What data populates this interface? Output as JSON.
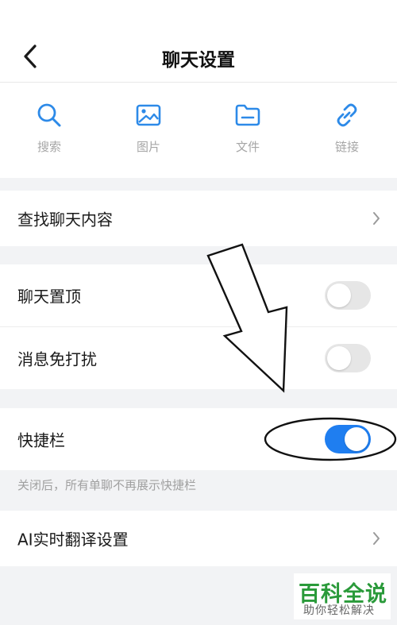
{
  "header": {
    "title": "聊天设置",
    "back_icon": "chevron-left-icon"
  },
  "quick_actions": [
    {
      "label": "搜索",
      "icon": "search-icon"
    },
    {
      "label": "图片",
      "icon": "image-icon"
    },
    {
      "label": "文件",
      "icon": "folder-icon"
    },
    {
      "label": "链接",
      "icon": "link-icon"
    }
  ],
  "rows": {
    "find_chat": {
      "label": "查找聊天内容"
    },
    "pin_chat": {
      "label": "聊天置顶",
      "toggle": false
    },
    "mute": {
      "label": "消息免打扰",
      "toggle": false
    },
    "shortcut_bar": {
      "label": "快捷栏",
      "toggle": true,
      "hint": "关闭后，所有单聊不再展示快捷栏"
    },
    "ai_translate": {
      "label": "AI实时翻译设置"
    }
  },
  "watermark": {
    "title": "百科全说",
    "subtitle": "助你轻松解决"
  },
  "colors": {
    "accent": "#1f7ef0",
    "toggle_off": "#e6e6e6",
    "background": "#f2f3f5",
    "watermark_green": "#2a9a3a"
  }
}
